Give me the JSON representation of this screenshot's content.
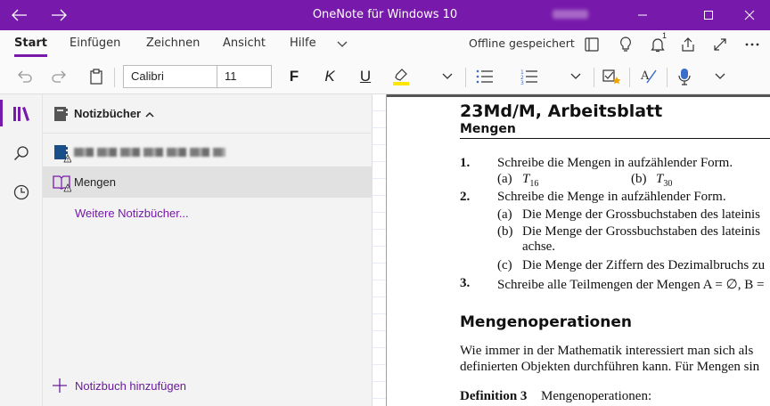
{
  "window": {
    "title": "OneNote für Windows 10"
  },
  "tabs": [
    {
      "label": "Start"
    },
    {
      "label": "Einfügen"
    },
    {
      "label": "Zeichnen"
    },
    {
      "label": "Ansicht"
    },
    {
      "label": "Hilfe"
    }
  ],
  "status": {
    "offline": "Offline gespeichert",
    "notification_count": "1"
  },
  "toolbar": {
    "font_name": "Calibri",
    "font_size": "11",
    "bold": "F",
    "italic": "K",
    "underline": "U"
  },
  "notebooks": {
    "header": "Notizbücher",
    "items": [
      {
        "label": "Mengen"
      }
    ],
    "more": "Weitere Notizbücher...",
    "add": "Notizbuch hinzufügen"
  },
  "document": {
    "title": "23Md/M, Arbeitsblatt",
    "subtitle": "Mengen",
    "items": [
      {
        "num": "1.",
        "text": "Schreibe die Mengen in aufzählender Form."
      },
      {
        "sub_a": "(a)",
        "sub_a_text": "T",
        "sub_a_idx": "16",
        "sub_b": "(b)",
        "sub_b_text": "T",
        "sub_b_idx": "30"
      },
      {
        "num": "2.",
        "text": "Schreibe die Menge in aufzählender Form."
      },
      {
        "sub": "(a)",
        "text": "Die Menge der Grossbuchstaben des lateinis"
      },
      {
        "sub": "(b)",
        "text": "Die Menge der Grossbuchstaben des lateinis"
      },
      {
        "text": "achse."
      },
      {
        "sub": "(c)",
        "text": "Die Menge der Ziffern des Dezimalbruchs zu"
      },
      {
        "num": "3.",
        "text": "Schreibe alle Teilmengen der Mengen A = ∅, B ="
      }
    ],
    "section": "Mengenoperationen",
    "para1": "Wie immer in der Mathematik interessiert man sich als",
    "para2": "definierten Objekten durchführen kann. Für Mengen sin",
    "def_label": "Definition 3",
    "def_text": "Mengenoperationen:"
  },
  "colors": {
    "accent": "#7719aa",
    "highlight": "#ffe600"
  }
}
